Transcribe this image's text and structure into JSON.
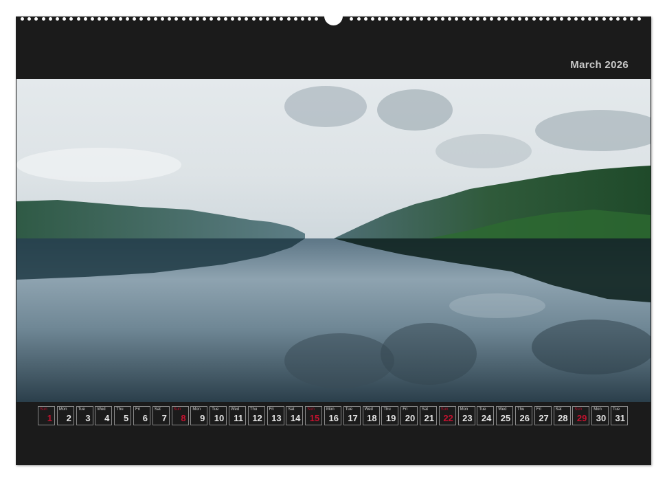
{
  "calendar": {
    "month_title": "March 2026",
    "accent_color": "#c3122f",
    "background_color": "#1b1b1b",
    "days": [
      {
        "wd": "Sun",
        "num": "1",
        "sunday": true
      },
      {
        "wd": "Mon",
        "num": "2"
      },
      {
        "wd": "Tue",
        "num": "3"
      },
      {
        "wd": "Wed",
        "num": "4"
      },
      {
        "wd": "Thu",
        "num": "5"
      },
      {
        "wd": "Fri",
        "num": "6"
      },
      {
        "wd": "Sat",
        "num": "7"
      },
      {
        "wd": "Sun",
        "num": "8",
        "sunday": true
      },
      {
        "wd": "Mon",
        "num": "9"
      },
      {
        "wd": "Tue",
        "num": "10"
      },
      {
        "wd": "Wed",
        "num": "11"
      },
      {
        "wd": "Thu",
        "num": "12"
      },
      {
        "wd": "Fri",
        "num": "13"
      },
      {
        "wd": "Sat",
        "num": "14"
      },
      {
        "wd": "Sun",
        "num": "15",
        "sunday": true
      },
      {
        "wd": "Mon",
        "num": "16"
      },
      {
        "wd": "Tue",
        "num": "17"
      },
      {
        "wd": "Wed",
        "num": "18"
      },
      {
        "wd": "Thu",
        "num": "19"
      },
      {
        "wd": "Fri",
        "num": "20"
      },
      {
        "wd": "Sat",
        "num": "21"
      },
      {
        "wd": "Sun",
        "num": "22",
        "sunday": true
      },
      {
        "wd": "Mon",
        "num": "23"
      },
      {
        "wd": "Tue",
        "num": "24"
      },
      {
        "wd": "Wed",
        "num": "25"
      },
      {
        "wd": "Thu",
        "num": "26"
      },
      {
        "wd": "Fri",
        "num": "27"
      },
      {
        "wd": "Sat",
        "num": "28"
      },
      {
        "wd": "Sun",
        "num": "29",
        "sunday": true
      },
      {
        "wd": "Mon",
        "num": "30"
      },
      {
        "wd": "Tue",
        "num": "31"
      }
    ]
  }
}
